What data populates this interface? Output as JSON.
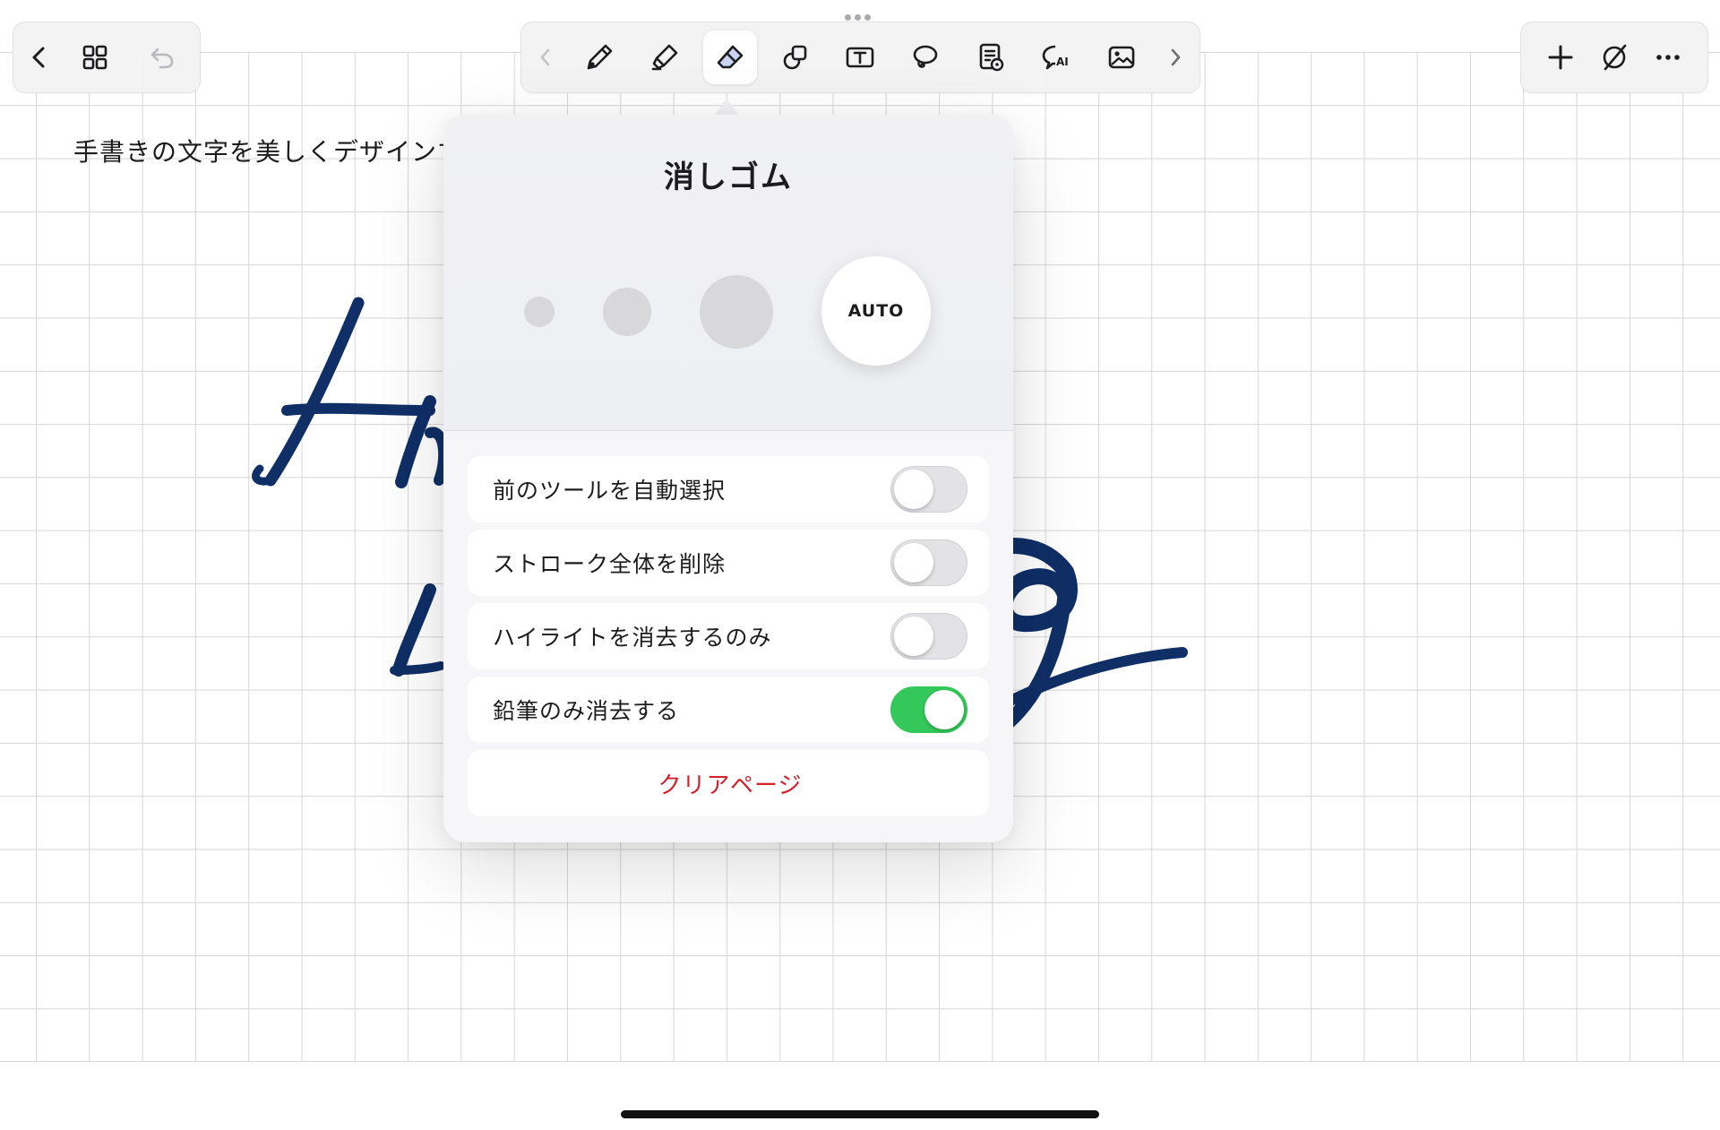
{
  "canvas": {
    "text_line": "手書きの文字を美しくデザインする技術です。",
    "ink_color": "#0f2f66",
    "grid_color": "#d6d6d6"
  },
  "toolbar_left": {
    "items": [
      {
        "name": "back-chevron-icon",
        "glyph": "chevron-left"
      },
      {
        "name": "grid-view-icon",
        "glyph": "grid-2x2"
      },
      {
        "name": "undo-icon",
        "glyph": "undo",
        "disabled": true
      }
    ]
  },
  "toolbar_center": {
    "items": [
      {
        "name": "scroll-left-chevron-icon",
        "glyph": "chevron-left",
        "disabled": true
      },
      {
        "name": "pen-icon",
        "glyph": "pen"
      },
      {
        "name": "highlighter-icon",
        "glyph": "highlighter"
      },
      {
        "name": "eraser-icon",
        "glyph": "eraser",
        "active": true
      },
      {
        "name": "shapes-icon",
        "glyph": "shapes"
      },
      {
        "name": "text-box-icon",
        "glyph": "text-box"
      },
      {
        "name": "lasso-icon",
        "glyph": "lasso"
      },
      {
        "name": "sticker-document-icon",
        "glyph": "document-badge"
      },
      {
        "name": "ai-chat-icon",
        "glyph": "ai-chat"
      },
      {
        "name": "image-icon",
        "glyph": "image"
      },
      {
        "name": "scroll-right-chevron-icon",
        "glyph": "chevron-right"
      }
    ]
  },
  "toolbar_right": {
    "items": [
      {
        "name": "add-icon",
        "glyph": "plus"
      },
      {
        "name": "pencil-off-icon",
        "glyph": "slash-circle"
      },
      {
        "name": "more-icon",
        "glyph": "ellipsis"
      }
    ]
  },
  "eraser_popover": {
    "title": "消しゴム",
    "sizes": [
      {
        "name": "size-small"
      },
      {
        "name": "size-medium"
      },
      {
        "name": "size-large"
      },
      {
        "name": "size-auto",
        "label": "AUTO",
        "selected": true
      }
    ],
    "options": [
      {
        "label": "前のツールを自動選択",
        "on": false
      },
      {
        "label": "ストローク全体を削除",
        "on": false
      },
      {
        "label": "ハイライトを消去するのみ",
        "on": false
      },
      {
        "label": "鉛筆のみ消去する",
        "on": true
      }
    ],
    "clear_page_label": "クリアページ",
    "toggle_on_color": "#34c759",
    "destructive_color": "#d3202a"
  }
}
